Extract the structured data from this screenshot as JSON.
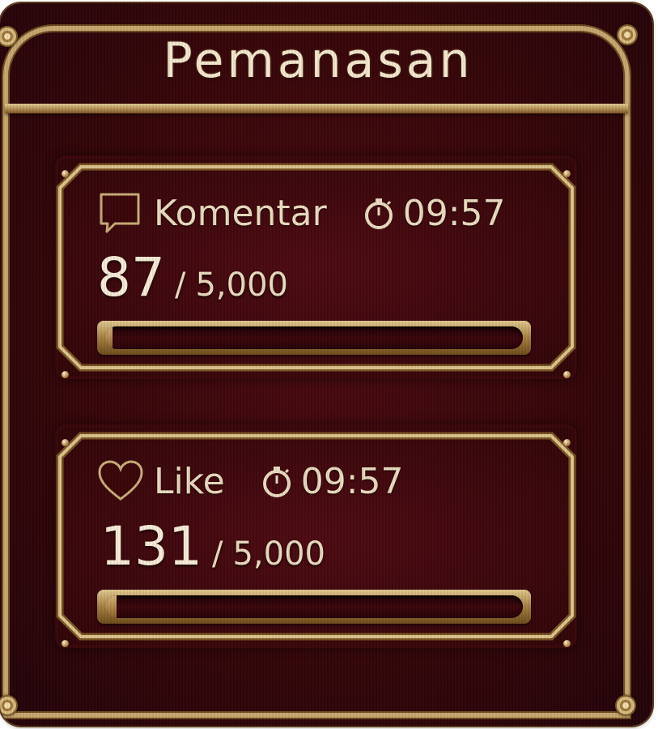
{
  "title": "Pemanasan",
  "colors": {
    "background": "#360609",
    "frame": "#c8a870",
    "text": "#eadcc0"
  },
  "cards": [
    {
      "label": "Komentar",
      "icon": "chat-bubble-icon",
      "timer_icon": "stopwatch-icon",
      "timer": "09:57",
      "current": "87",
      "separator": "/",
      "total": "5,000",
      "progress": 0.0174
    },
    {
      "label": "Like",
      "icon": "heart-icon",
      "timer_icon": "stopwatch-icon",
      "timer": "09:57",
      "current": "131",
      "separator": "/",
      "total": "5,000",
      "progress": 0.0262
    }
  ]
}
